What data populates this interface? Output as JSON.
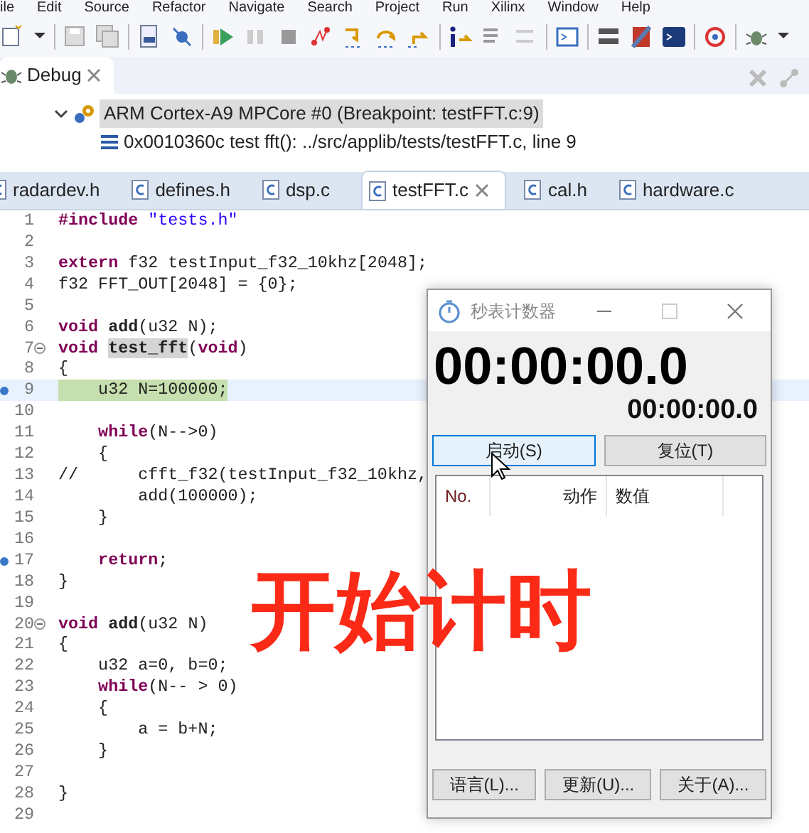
{
  "menu": [
    "ile",
    "Edit",
    "Source",
    "Refactor",
    "Navigate",
    "Search",
    "Project",
    "Run",
    "Xilinx",
    "Window",
    "Help"
  ],
  "debug_view": {
    "tab": {
      "label": "Debug",
      "selected": true
    },
    "tree": [
      {
        "label": "ARM Cortex-A9 MPCore #0 (Breakpoint: testFFT.c:9)",
        "expanded": true,
        "selected": true,
        "children": [
          {
            "label": "0x0010360c test fft(): ../src/applib/tests/testFFT.c, line 9",
            "selected": false
          }
        ]
      }
    ]
  },
  "editor_tabs": [
    {
      "label": "radardev.h",
      "selected": false
    },
    {
      "label": "defines.h",
      "selected": false
    },
    {
      "label": "dsp.c",
      "selected": false
    },
    {
      "label": "testFFT.c",
      "selected": true
    },
    {
      "label": "cal.h",
      "selected": false
    },
    {
      "label": "hardware.c",
      "selected": false
    }
  ],
  "code_lines": [
    {
      "number": "1",
      "tokens": [
        {
          "text": "#include",
          "kind": "keyword"
        },
        {
          "text": " \"tests.h\"",
          "kind": "string"
        }
      ],
      "current": false,
      "fold": false,
      "breakpoint": false
    },
    {
      "number": "2",
      "current": false,
      "fold": false,
      "breakpoint": false
    },
    {
      "number": "3",
      "tokens": [
        {
          "text": "extern",
          "kind": "keyword"
        },
        {
          "text": " f32 testInput_f32_10khz[2048];",
          "kind": "plain"
        }
      ],
      "current": false,
      "fold": false,
      "breakpoint": false
    },
    {
      "number": "4",
      "tokens": [
        {
          "text": "f32 FFT_OUT[2048] = {0};",
          "kind": "plain"
        }
      ],
      "current": false,
      "fold": false,
      "breakpoint": false
    },
    {
      "number": "5",
      "current": false,
      "fold": false,
      "breakpoint": false
    },
    {
      "number": "6",
      "tokens": [
        {
          "text": "void ",
          "kind": "keyword"
        },
        {
          "text": "add",
          "kind": "function"
        },
        {
          "text": "(u32 N);",
          "kind": "plain"
        }
      ],
      "current": false,
      "fold": false,
      "breakpoint": false
    },
    {
      "number": "7",
      "tokens": [
        {
          "text": "void ",
          "kind": "keyword"
        },
        {
          "text": "test_fft",
          "kind": "occurrence"
        },
        {
          "text": "(",
          "kind": "plain"
        },
        {
          "text": "void",
          "kind": "keyword"
        },
        {
          "text": ")",
          "kind": "plain"
        }
      ],
      "current": false,
      "fold": true,
      "breakpoint": false
    },
    {
      "number": "8",
      "tokens": [
        {
          "text": "{",
          "kind": "plain"
        }
      ],
      "current": false,
      "fold": false,
      "breakpoint": false
    },
    {
      "number": "9",
      "tokens": [
        {
          "text": "    u32 N=100000;",
          "kind": "plain"
        }
      ],
      "current": true,
      "fold": false,
      "breakpoint": true
    },
    {
      "number": "10",
      "current": false,
      "fold": false,
      "breakpoint": false
    },
    {
      "number": "11",
      "tokens": [
        {
          "text": "    while",
          "kind": "keyword"
        },
        {
          "text": "(N-->0)",
          "kind": "plain"
        }
      ],
      "current": false,
      "fold": false,
      "breakpoint": false
    },
    {
      "number": "12",
      "tokens": [
        {
          "text": "    {",
          "kind": "plain"
        }
      ],
      "current": false,
      "fold": false,
      "breakpoint": false
    },
    {
      "number": "13",
      "tokens": [
        {
          "text": "//      cfft_f32(testInput_f32_10khz,",
          "kind": "plain"
        }
      ],
      "current": false,
      "fold": false,
      "breakpoint": false
    },
    {
      "number": "14",
      "tokens": [
        {
          "text": "        add(100000);",
          "kind": "plain"
        }
      ],
      "current": false,
      "fold": false,
      "breakpoint": false
    },
    {
      "number": "15",
      "tokens": [
        {
          "text": "    }",
          "kind": "plain"
        }
      ],
      "current": false,
      "fold": false,
      "breakpoint": false
    },
    {
      "number": "16",
      "current": false,
      "fold": false,
      "breakpoint": false
    },
    {
      "number": "17",
      "tokens": [
        {
          "text": "    return",
          "kind": "keyword"
        },
        {
          "text": ";",
          "kind": "plain"
        }
      ],
      "current": false,
      "fold": false,
      "breakpoint": true
    },
    {
      "number": "18",
      "tokens": [
        {
          "text": "}",
          "kind": "plain"
        }
      ],
      "current": false,
      "fold": false,
      "breakpoint": false
    },
    {
      "number": "19",
      "current": false,
      "fold": false,
      "breakpoint": false
    },
    {
      "number": "20",
      "tokens": [
        {
          "text": "void ",
          "kind": "keyword"
        },
        {
          "text": "add",
          "kind": "function"
        },
        {
          "text": "(u32 N)",
          "kind": "plain"
        }
      ],
      "current": false,
      "fold": true,
      "breakpoint": false
    },
    {
      "number": "21",
      "tokens": [
        {
          "text": "{",
          "kind": "plain"
        }
      ],
      "current": false,
      "fold": false,
      "breakpoint": false
    },
    {
      "number": "22",
      "tokens": [
        {
          "text": "    u32 a=0, b=0;",
          "kind": "plain"
        }
      ],
      "current": false,
      "fold": false,
      "breakpoint": false
    },
    {
      "number": "23",
      "tokens": [
        {
          "text": "    while",
          "kind": "keyword"
        },
        {
          "text": "(N-- > 0)",
          "kind": "plain"
        }
      ],
      "current": false,
      "fold": false,
      "breakpoint": false
    },
    {
      "number": "24",
      "tokens": [
        {
          "text": "    {",
          "kind": "plain"
        }
      ],
      "current": false,
      "fold": false,
      "breakpoint": false
    },
    {
      "number": "25",
      "tokens": [
        {
          "text": "        a = b+N;",
          "kind": "plain"
        }
      ],
      "current": false,
      "fold": false,
      "breakpoint": false
    },
    {
      "number": "26",
      "tokens": [
        {
          "text": "    }",
          "kind": "plain"
        }
      ],
      "current": false,
      "fold": false,
      "breakpoint": false
    },
    {
      "number": "27",
      "current": false,
      "fold": false,
      "breakpoint": false
    },
    {
      "number": "28",
      "tokens": [
        {
          "text": "}",
          "kind": "plain"
        }
      ],
      "current": false,
      "fold": false,
      "breakpoint": false
    },
    {
      "number": "29",
      "current": false,
      "fold": false,
      "breakpoint": false
    }
  ],
  "stopwatch": {
    "title": "秒表计数器",
    "main_time": "00:00:00.0",
    "lap_time": "00:00:00.0",
    "buttons": [
      {
        "label": "启动(S)",
        "focused": true
      },
      {
        "label": "复位(T)",
        "focused": false
      }
    ],
    "table": {
      "columns": [
        "No.",
        "动作",
        "数值"
      ]
    },
    "footer_buttons": [
      "语言(L)...",
      "更新(U)...",
      "关于(A)..."
    ]
  },
  "caption": "开始计时"
}
